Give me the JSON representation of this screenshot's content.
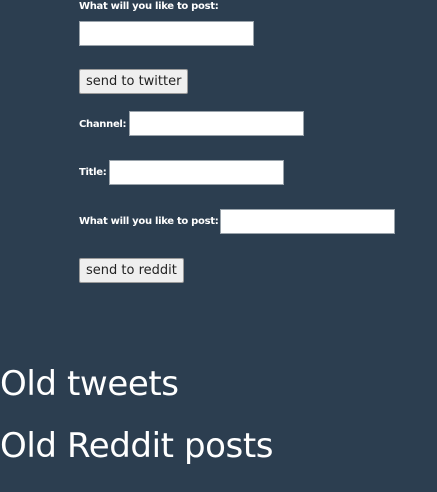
{
  "twitter": {
    "post_label": "What will you like to post:",
    "post_value": "",
    "send_label": "send to twitter"
  },
  "reddit": {
    "channel_label": "Channel:",
    "channel_value": "",
    "title_label": "Title:",
    "title_value": "",
    "post_label": "What will you like to post:",
    "post_value": "",
    "send_label": "send to reddit"
  },
  "sections": {
    "old_tweets": "Old tweets",
    "old_reddit": "Old Reddit posts"
  }
}
